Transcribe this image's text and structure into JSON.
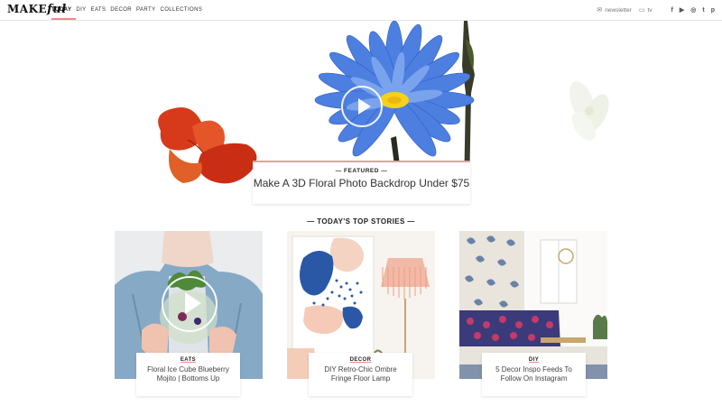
{
  "nav": {
    "logo_main": "MAKE",
    "logo_script": "ful",
    "items": [
      "TODAY",
      "DIY",
      "EATS",
      "DECOR",
      "PARTY",
      "COLLECTIONS"
    ],
    "active": "TODAY",
    "newsletter": "newsletter",
    "tv": "tv",
    "social_icons": [
      "facebook-icon",
      "youtube-icon",
      "instagram-icon",
      "twitter-icon",
      "pinterest-icon"
    ],
    "social_glyphs": [
      "f",
      "▶",
      "◎",
      "t",
      "p"
    ]
  },
  "featured": {
    "tag": "FEATURED",
    "title": "Make A 3D Floral Photo Backdrop Under $75"
  },
  "section": {
    "title": "TODAY'S TOP STORIES"
  },
  "stories": [
    {
      "tag": "EATS",
      "title": "Floral Ice Cube Blueberry Mojito | Bottoms Up",
      "has_video": true
    },
    {
      "tag": "DECOR",
      "title": "DIY Retro-Chic Ombre Fringe Floor Lamp",
      "has_video": false
    },
    {
      "tag": "DIY",
      "title": "5 Decor Inspo Feeds To Follow On Instagram",
      "has_video": false
    }
  ],
  "colors": {
    "accent": "#e88888",
    "blue_flower": "#3f6ed6",
    "red_flower": "#d9381e"
  }
}
